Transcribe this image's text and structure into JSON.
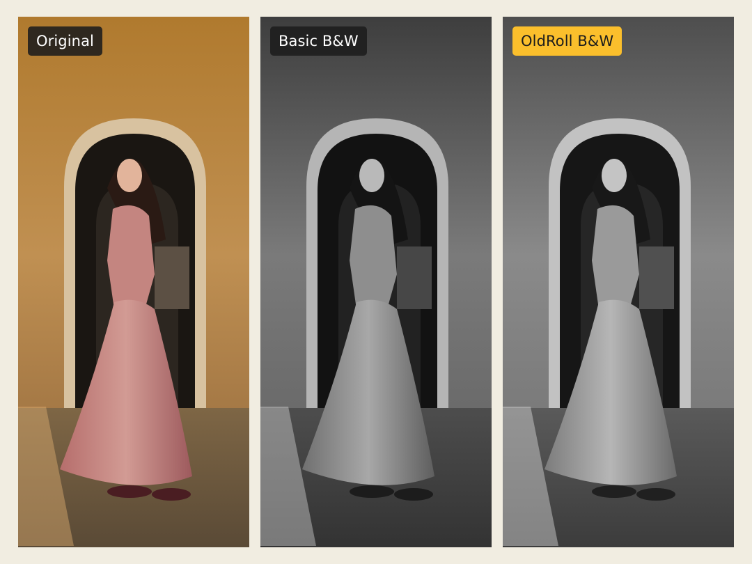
{
  "comparison": {
    "panels": [
      {
        "label": "Original",
        "style": "color"
      },
      {
        "label": "Basic B&W",
        "style": "grayscale"
      },
      {
        "label": "OldRoll B&W",
        "style": "grayscale-film"
      }
    ],
    "accent_color": "#fbbf2c"
  }
}
